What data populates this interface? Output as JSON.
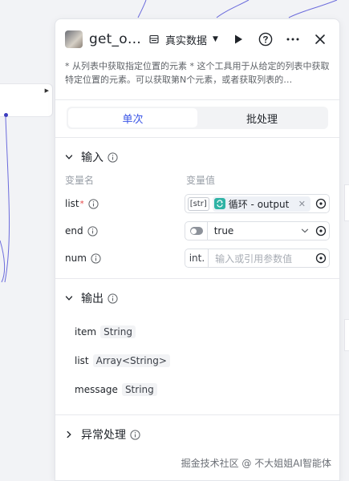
{
  "header": {
    "title": "get_o…",
    "mode_label": "真实数据",
    "icons": {
      "avatar": "user-avatar",
      "mode": "database-icon",
      "caret": "caret-down-icon",
      "run": "play-icon",
      "help": "help-circle-icon",
      "more": "more-horizontal-icon",
      "close": "close-icon"
    }
  },
  "description": "* 从列表中获取指定位置的元素 * 这个工具用于从给定的列表中获取特定位置的元素。可以获取第N个元素，或者获取列表的…",
  "tabs": [
    {
      "label": "单次",
      "active": true
    },
    {
      "label": "批处理",
      "active": false
    }
  ],
  "inputs": {
    "title": "输入",
    "col_name": "变量名",
    "col_value": "变量值",
    "params": [
      {
        "name": "list",
        "required": true,
        "type_tag": "[str]",
        "value": "循环 - output"
      },
      {
        "name": "end",
        "required": false,
        "value": "true"
      },
      {
        "name": "num",
        "required": false,
        "type_tag": "int.",
        "placeholder": "输入或引用参数值"
      }
    ]
  },
  "outputs": {
    "title": "输出",
    "items": [
      {
        "name": "item",
        "type": "String"
      },
      {
        "name": "list",
        "type": "Array<String>"
      },
      {
        "name": "message",
        "type": "String"
      }
    ]
  },
  "exception": {
    "title": "异常处理"
  },
  "watermark": "掘金技术社区 @ 不大姐姐AI智能体",
  "colors": {
    "accent": "#3a55e6",
    "loop_icon": "#2fb3a5",
    "required": "#e64545",
    "connector_line": "#6b6bdc"
  }
}
